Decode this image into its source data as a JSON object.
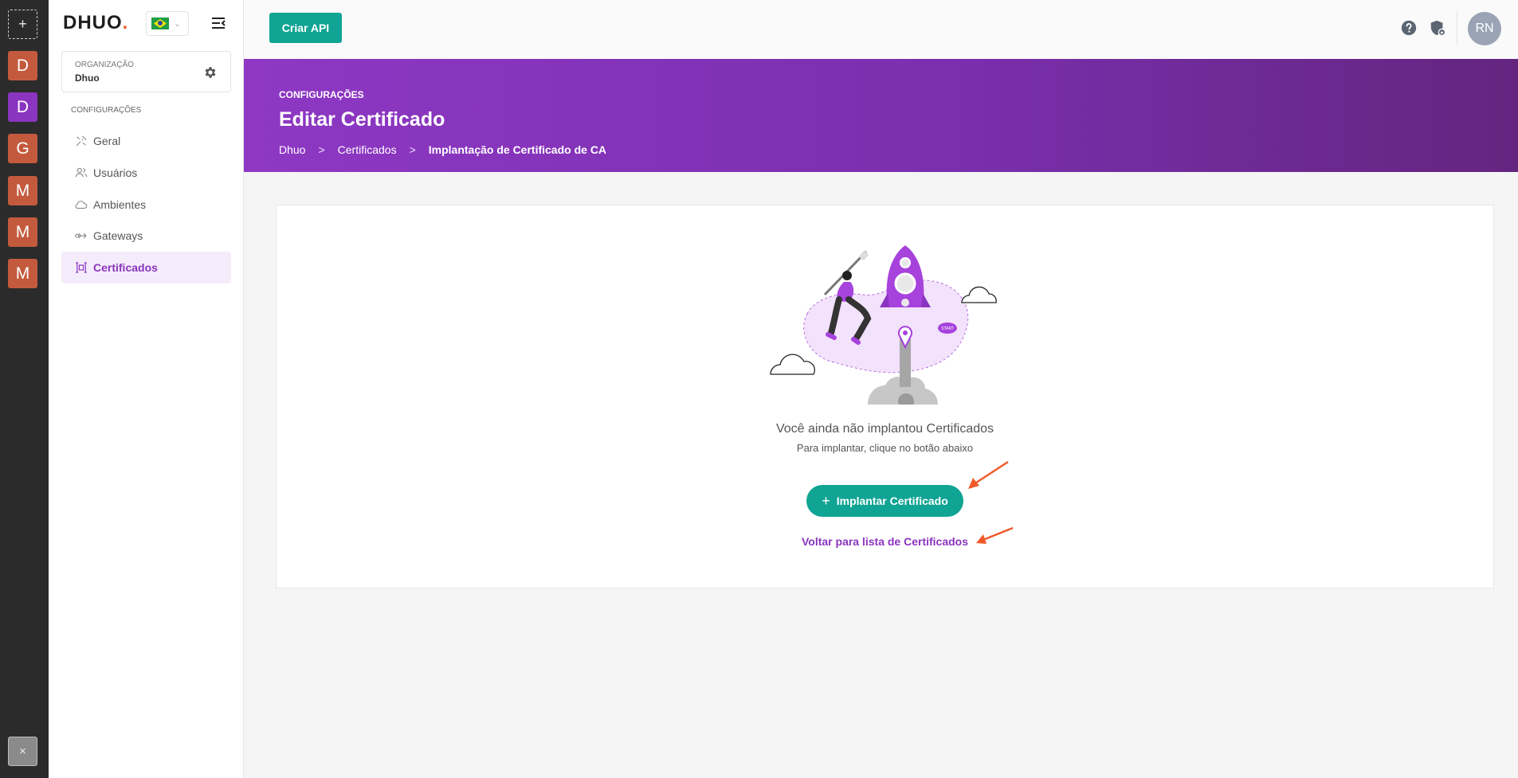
{
  "rail": {
    "add_symbol": "+",
    "orgs": [
      {
        "letter": "D",
        "color": "#c45a3d"
      },
      {
        "letter": "D",
        "color": "#8a35bf"
      },
      {
        "letter": "G",
        "color": "#c45a3d"
      },
      {
        "letter": "M",
        "color": "#c45a3d"
      },
      {
        "letter": "M",
        "color": "#c45a3d"
      },
      {
        "letter": "M",
        "color": "#c45a3d"
      }
    ],
    "close_symbol": "×"
  },
  "sidebar": {
    "logo_text": "DHUO",
    "logo_dot": ".",
    "language_icon": "flag-brazil-icon",
    "organization_label": "ORGANIZAÇÃO",
    "organization_name": "Dhuo",
    "section_label": "CONFIGURAÇÕES",
    "items": [
      {
        "label": "Geral",
        "icon": "tools-icon",
        "active": false
      },
      {
        "label": "Usuários",
        "icon": "users-icon",
        "active": false
      },
      {
        "label": "Ambientes",
        "icon": "cloud-icon",
        "active": false
      },
      {
        "label": "Gateways",
        "icon": "gateway-icon",
        "active": false
      },
      {
        "label": "Certificados",
        "icon": "certificate-icon",
        "active": true
      }
    ]
  },
  "topbar": {
    "create_api_label": "Criar API",
    "avatar_initials": "RN"
  },
  "header": {
    "section": "CONFIGURAÇÕES",
    "title": "Editar Certificado",
    "breadcrumb": [
      "Dhuo",
      "Certificados",
      "Implantação de Certificado de CA"
    ],
    "breadcrumb_separator": ">"
  },
  "empty_state": {
    "title": "Você ainda não implantou Certificados",
    "subtitle": "Para implantar, clique no botão abaixo",
    "deploy_button_label": "Implantar Certificado",
    "deploy_button_symbol": "+",
    "back_link_label": "Voltar para lista de Certificados",
    "illustration_badge": "START"
  },
  "colors": {
    "primary": "#10a494",
    "accent_purple": "#8a35bf",
    "annotation_arrow": "#f05a28"
  }
}
